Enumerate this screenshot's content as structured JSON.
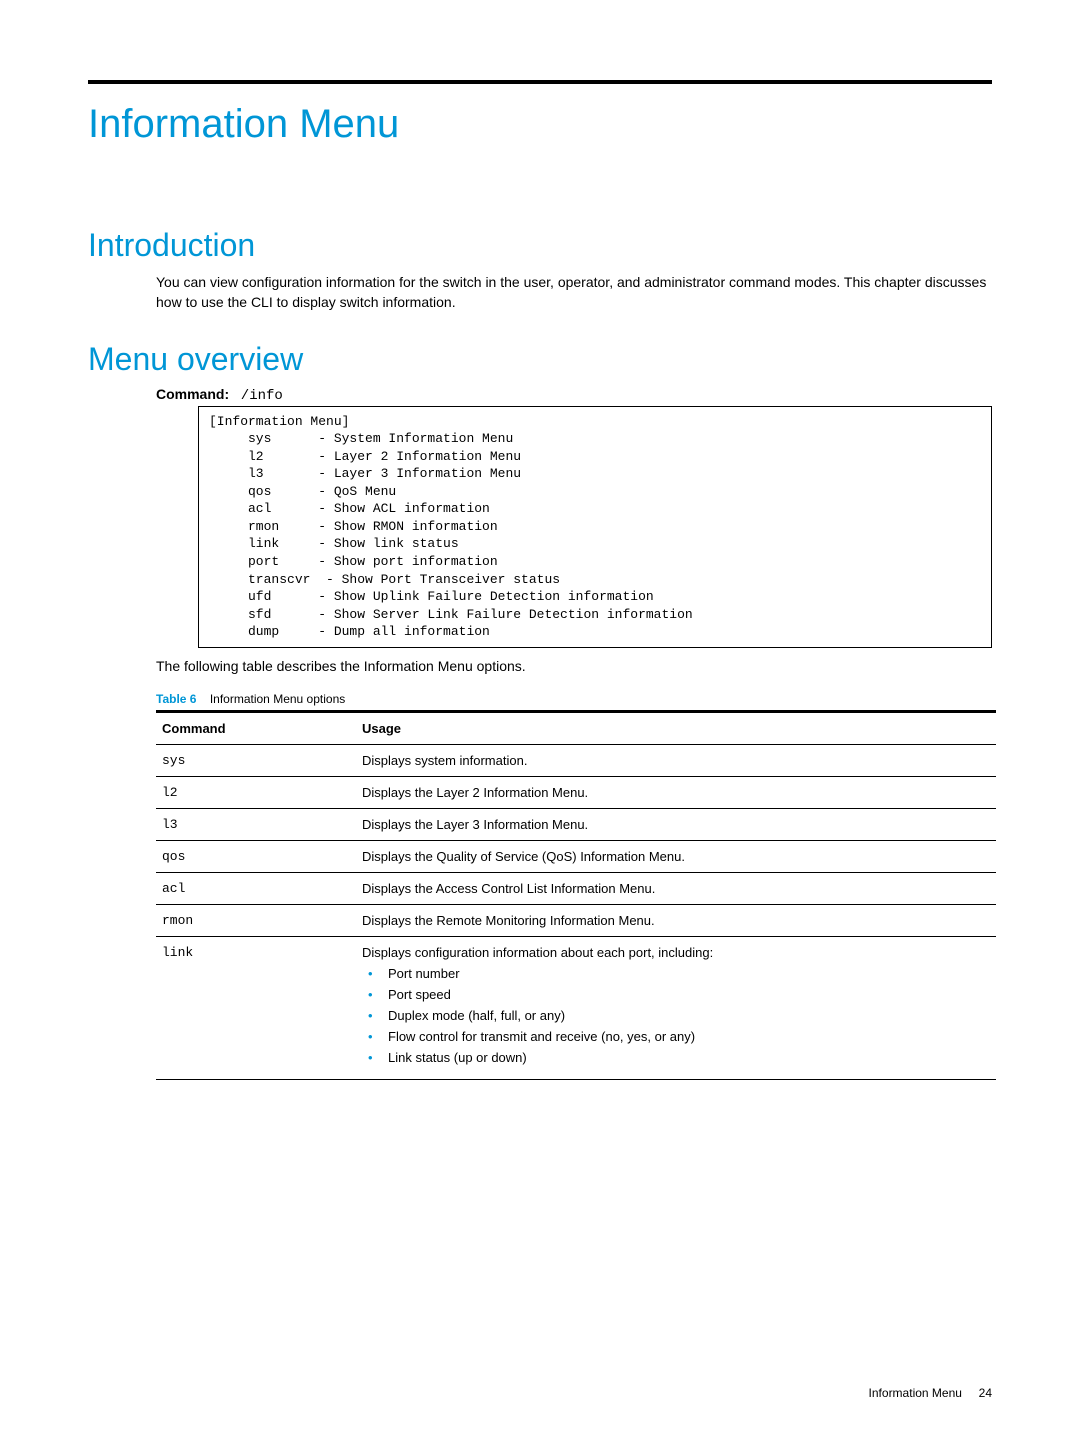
{
  "title": "Information Menu",
  "sections": {
    "introduction": {
      "heading": "Introduction",
      "body": "You can view configuration information for the switch in the user, operator, and administrator command modes. This chapter discusses how to use the CLI to display switch information."
    },
    "overview": {
      "heading": "Menu overview",
      "command_label": "Command:",
      "command_value": "/info",
      "cli_title": "[Information Menu]",
      "cli_rows": [
        {
          "key": "sys",
          "desc": "System Information Menu"
        },
        {
          "key": "l2",
          "desc": "Layer 2 Information Menu"
        },
        {
          "key": "l3",
          "desc": "Layer 3 Information Menu"
        },
        {
          "key": "qos",
          "desc": "QoS Menu"
        },
        {
          "key": "acl",
          "desc": "Show ACL information"
        },
        {
          "key": "rmon",
          "desc": "Show RMON information"
        },
        {
          "key": "link",
          "desc": "Show link status"
        },
        {
          "key": "port",
          "desc": "Show port information"
        },
        {
          "key": "transcvr",
          "desc": "Show Port Transceiver status"
        },
        {
          "key": "ufd",
          "desc": "Show Uplink Failure Detection information"
        },
        {
          "key": "sfd",
          "desc": "Show Server Link Failure Detection information"
        },
        {
          "key": "dump",
          "desc": "Dump all information"
        }
      ],
      "table_intro": "The following table describes the Information Menu options.",
      "table_caption_label": "Table 6",
      "table_caption_text": "Information Menu options",
      "columns": {
        "c1": "Command",
        "c2": "Usage"
      },
      "rows": [
        {
          "cmd": "sys",
          "usage": "Displays system information."
        },
        {
          "cmd": "l2",
          "usage": "Displays the Layer 2 Information Menu."
        },
        {
          "cmd": "l3",
          "usage": "Displays the Layer 3 Information Menu."
        },
        {
          "cmd": "qos",
          "usage": "Displays the Quality of Service (QoS) Information Menu."
        },
        {
          "cmd": "acl",
          "usage": "Displays the Access Control List Information Menu."
        },
        {
          "cmd": "rmon",
          "usage": "Displays the Remote Monitoring Information Menu."
        },
        {
          "cmd": "link",
          "usage": "Displays configuration information about each port, including:",
          "bullets": [
            "Port number",
            "Port speed",
            "Duplex mode (half, full, or any)",
            "Flow control for transmit and receive (no, yes, or any)",
            "Link status (up or down)"
          ]
        }
      ]
    }
  },
  "footer": {
    "text": "Information Menu",
    "page": "24"
  }
}
